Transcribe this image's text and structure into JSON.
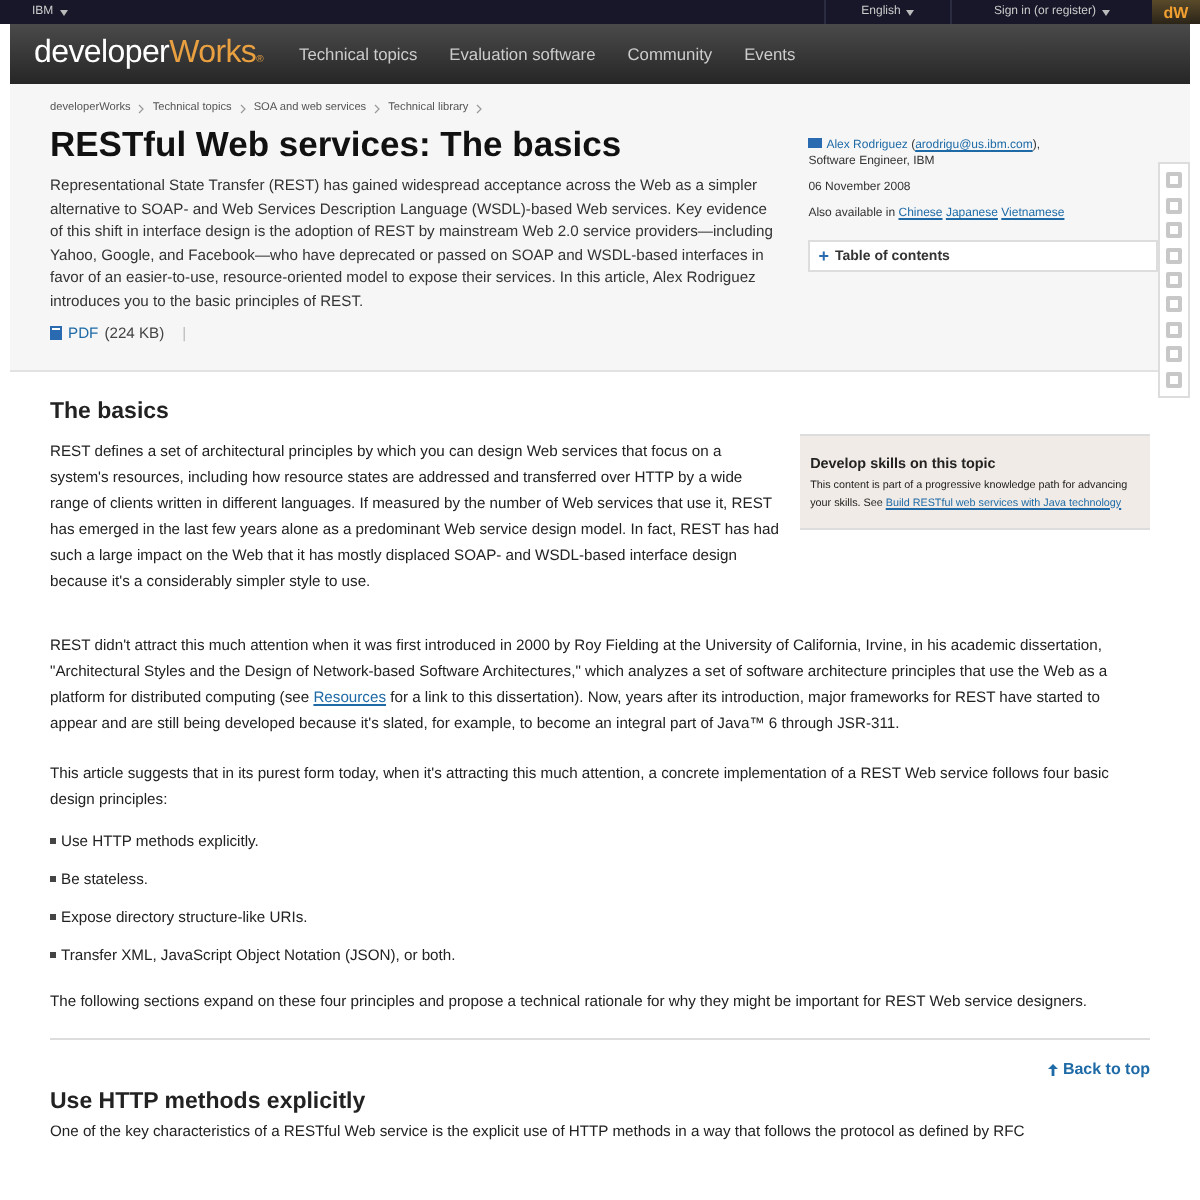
{
  "top_bar": {
    "brand": "IBM",
    "language": "English",
    "sign_in": "Sign in (or register)",
    "badge": "dW"
  },
  "nav": {
    "logo_main": "developer",
    "logo_accent": "Works",
    "logo_mark": "®",
    "items": [
      "Technical topics",
      "Evaluation software",
      "Community",
      "Events"
    ]
  },
  "breadcrumbs": [
    "developerWorks",
    "Technical topics",
    "SOA and web services",
    "Technical library"
  ],
  "title": "RESTful Web services: The basics",
  "abstract": "Representational State Transfer (REST) has gained widespread acceptance across the Web as a simpler alternative to SOAP- and Web Services Description Language (WSDL)-based Web services. Key evidence of this shift in interface design is the adoption of REST by mainstream Web 2.0 service providers—including Yahoo, Google, and Facebook—who have deprecated or passed on SOAP and WSDL-based interfaces in favor of an easier-to-use, resource-oriented model to expose their services. In this article, Alex Rodriguez introduces you to the basic principles of REST.",
  "pdf": {
    "label": "PDF",
    "size": "(224 KB)",
    "separator": "|"
  },
  "author": {
    "name": "Alex Rodriguez",
    "open": "(",
    "email": "arodrigu@us.ibm.com",
    "close": "),",
    "role": "Software Engineer, IBM",
    "date": "06 November 2008",
    "also_label": "Also available in",
    "languages": [
      "Chinese",
      "Japanese",
      "Vietnamese"
    ]
  },
  "toc": {
    "icon": "+",
    "label": "Table of contents"
  },
  "section": {
    "heading": "The basics",
    "paragraph_1": "REST defines a set of architectural principles by which you can design Web services that focus on a system's resources, including how resource states are addressed and transferred over HTTP by a wide range of clients written in different languages. If measured by the number of Web services that use it, REST has emerged in the last few years alone as a predominant Web service design model. In fact, REST has had such a large impact on the Web that it has mostly displaced SOAP- and WSDL-based interface design because it's a considerably simpler style to use.",
    "sidebar": {
      "title": "Develop skills on this topic",
      "text": "This content is part of a progressive knowledge path for advancing your skills. See",
      "link": "Build RESTful web services with Java technology"
    },
    "paragraph_2": {
      "before": "REST didn't attract this much attention when it was first introduced in 2000 by Roy Fielding at the University of California, Irvine, in his academic dissertation, \"Architectural Styles and the Design of Network-based Software Architectures,\" which analyzes a set of software architecture principles that use the Web as a platform for distributed computing (see",
      "link": "Resources",
      "after": "for a link to this dissertation). Now, years after its introduction, major frameworks for REST have started to appear and are still being developed because it's slated, for example, to become an integral part of Java™ 6 through JSR-311."
    },
    "paragraph_3": "This article suggests that in its purest form today, when it's attracting this much attention, a concrete implementation of a REST Web service follows four basic design principles:",
    "bullets": [
      "Use HTTP methods explicitly.",
      "Be stateless.",
      "Expose directory structure-like URIs.",
      "Transfer XML, JavaScript Object Notation (JSON), or both."
    ],
    "paragraph_4": "The following sections expand on these four principles and propose a technical rationale for why they might be important for REST Web service designers."
  },
  "back_to_top": "Back to top",
  "next_section": {
    "heading": "Use HTTP methods explicitly",
    "text": "One of the key characteristics of a RESTful Web service is the explicit use of HTTP methods in a way that follows the protocol as defined by RFC"
  }
}
